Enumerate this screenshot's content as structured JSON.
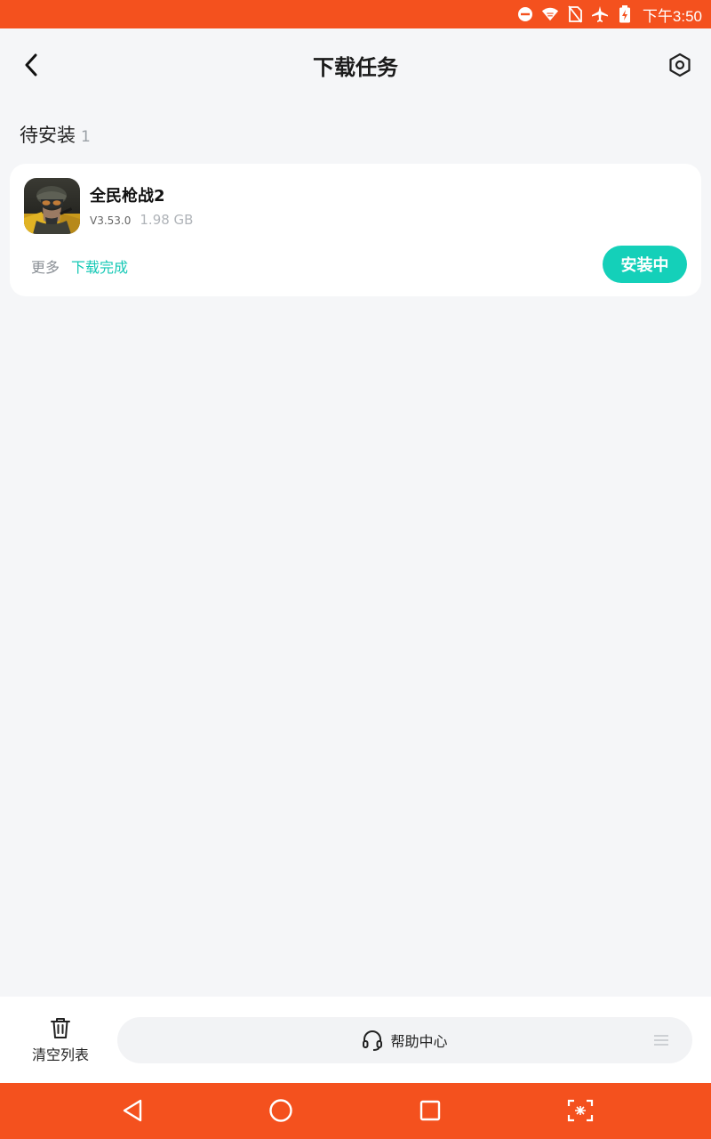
{
  "status_bar": {
    "time": "下午3:50",
    "icons": [
      "do-not-disturb-icon",
      "wifi-icon",
      "no-sim-icon",
      "airplane-icon",
      "battery-charging-icon"
    ],
    "background": "#f4511e"
  },
  "header": {
    "title": "下载任务",
    "back_icon": "chevron-left-icon",
    "settings_icon": "settings-hexagon-icon"
  },
  "section": {
    "label": "待安装",
    "count": "1"
  },
  "task": {
    "name": "全民枪战2",
    "version": "V3.53.0",
    "size": "1.98 GB",
    "more_label": "更多",
    "status_label": "下载完成",
    "action_label": "安装中",
    "accent_color": "#14d0b9"
  },
  "bottom_bar": {
    "clear_label": "清空列表",
    "help_label": "帮助中心"
  },
  "nav_bar": {
    "buttons": [
      "back-triangle-icon",
      "home-circle-icon",
      "recents-square-icon",
      "screenshot-icon"
    ]
  }
}
